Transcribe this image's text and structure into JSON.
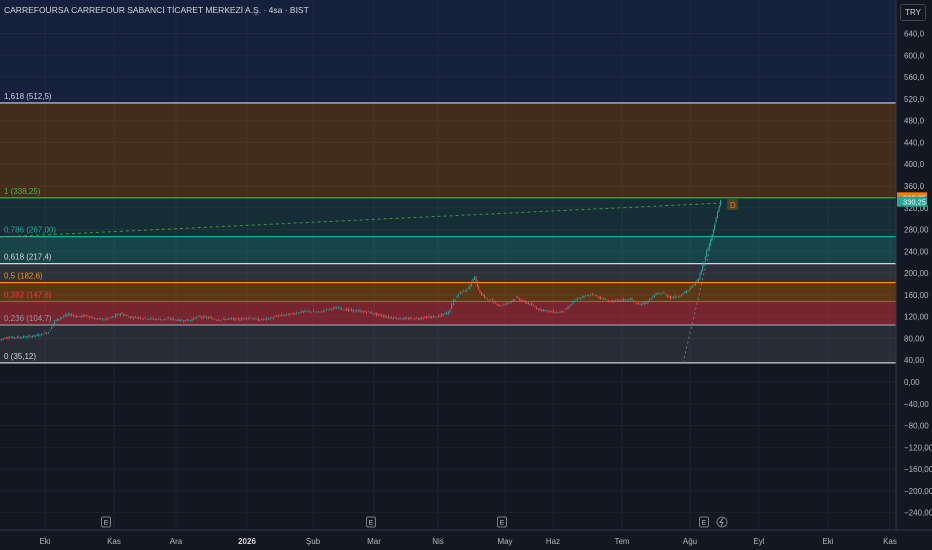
{
  "header": {
    "symbol_title": "CARREFOURSA CARREFOUR SABANCI TİCARET MERKEZİ A.Ş. · 4sa · BIST",
    "currency": "TRY"
  },
  "chart_data": {
    "type": "candlestick",
    "y_ticks": [
      "640,0",
      "600,0",
      "560,0",
      "520,0",
      "480,0",
      "440,0",
      "400,0",
      "360,0",
      "320,00",
      "280,00",
      "240,00",
      "200,00",
      "160,00",
      "120,00",
      "80,00",
      "40,00",
      "0,00",
      "−40,00",
      "−80,00",
      "−120,00",
      "−160,00",
      "−200,00",
      "−240,00"
    ],
    "y_tick_values": [
      640,
      600,
      560,
      520,
      480,
      440,
      400,
      360,
      320,
      280,
      240,
      200,
      160,
      120,
      80,
      40,
      0,
      -40,
      -80,
      -120,
      -160,
      -200,
      -240
    ],
    "x_ticks": [
      "Eki",
      "Kas",
      "Ara",
      "2026",
      "Şub",
      "Mar",
      "Nis",
      "May",
      "Haz",
      "Tem",
      "Ağu",
      "Eyl",
      "Eki",
      "Kas"
    ],
    "ylim": [
      -255,
      668
    ],
    "fib_levels": [
      {
        "label": "1,618 (512,5)",
        "value": 512.5,
        "color": "#d1d4dc"
      },
      {
        "label": "1 (338,25)",
        "value": 338.25,
        "color": "#4caf50"
      },
      {
        "label": "0,786 (267,00)",
        "value": 267.0,
        "color": "#26a69a"
      },
      {
        "label": "0,618 (217,4)",
        "value": 217.4,
        "color": "#d1d4dc"
      },
      {
        "label": "0,5 (182,6)",
        "value": 182.6,
        "color": "#ff9800"
      },
      {
        "label": "0,382 (147,8)",
        "value": 147.8,
        "color": "#f23645"
      },
      {
        "label": "0,236 (104,7)",
        "value": 104.7,
        "color": "#9598a1"
      },
      {
        "label": "0 (35,12)",
        "value": 35.12,
        "color": "#d1d4dc"
      }
    ],
    "price_labels": [
      {
        "text": "338,25",
        "value": 338.25,
        "color": "#f57c00"
      },
      {
        "text": "330,25",
        "value": 330.25,
        "color": "#26a69a"
      }
    ],
    "pattern_point_label": "D",
    "series": [
      {
        "values": [
          [
            0,
            77
          ],
          [
            8,
            82
          ],
          [
            16,
            82
          ],
          [
            28,
            83
          ],
          [
            40,
            86
          ],
          [
            50,
            92
          ],
          [
            56,
            112
          ],
          [
            62,
            118
          ],
          [
            70,
            124
          ],
          [
            80,
            120
          ],
          [
            88,
            122
          ],
          [
            96,
            116
          ],
          [
            106,
            115
          ],
          [
            114,
            119
          ],
          [
            122,
            126
          ],
          [
            132,
            119
          ],
          [
            142,
            118
          ],
          [
            152,
            116
          ],
          [
            162,
            115
          ],
          [
            172,
            116
          ],
          [
            182,
            113
          ],
          [
            192,
            114
          ],
          [
            200,
            120
          ],
          [
            210,
            118
          ],
          [
            220,
            114
          ],
          [
            230,
            116
          ],
          [
            240,
            115
          ],
          [
            250,
            118
          ],
          [
            260,
            114
          ],
          [
            270,
            116
          ],
          [
            280,
            122
          ],
          [
            290,
            124
          ],
          [
            300,
            128
          ],
          [
            310,
            130
          ],
          [
            320,
            128
          ],
          [
            330,
            134
          ],
          [
            340,
            136
          ],
          [
            350,
            132
          ],
          [
            360,
            130
          ],
          [
            370,
            128
          ],
          [
            380,
            123
          ],
          [
            390,
            119
          ],
          [
            400,
            117
          ],
          [
            410,
            116
          ],
          [
            420,
            117
          ],
          [
            430,
            119
          ],
          [
            440,
            120
          ],
          [
            450,
            128
          ],
          [
            455,
            150
          ],
          [
            462,
            165
          ],
          [
            470,
            172
          ],
          [
            476,
            194
          ],
          [
            480,
            168
          ],
          [
            486,
            155
          ],
          [
            494,
            148
          ],
          [
            502,
            140
          ],
          [
            510,
            146
          ],
          [
            518,
            155
          ],
          [
            524,
            148
          ],
          [
            530,
            144
          ],
          [
            540,
            134
          ],
          [
            550,
            130
          ],
          [
            560,
            128
          ],
          [
            568,
            134
          ],
          [
            576,
            150
          ],
          [
            584,
            156
          ],
          [
            594,
            162
          ],
          [
            602,
            154
          ],
          [
            612,
            148
          ],
          [
            622,
            150
          ],
          [
            632,
            152
          ],
          [
            640,
            142
          ],
          [
            648,
            146
          ],
          [
            656,
            160
          ],
          [
            664,
            164
          ],
          [
            672,
            155
          ],
          [
            680,
            158
          ],
          [
            688,
            166
          ],
          [
            694,
            176
          ],
          [
            700,
            190
          ],
          [
            704,
            214
          ],
          [
            708,
            240
          ],
          [
            712,
            262
          ],
          [
            716,
            290
          ],
          [
            719,
            312
          ],
          [
            722,
            335
          ]
        ]
      }
    ]
  }
}
